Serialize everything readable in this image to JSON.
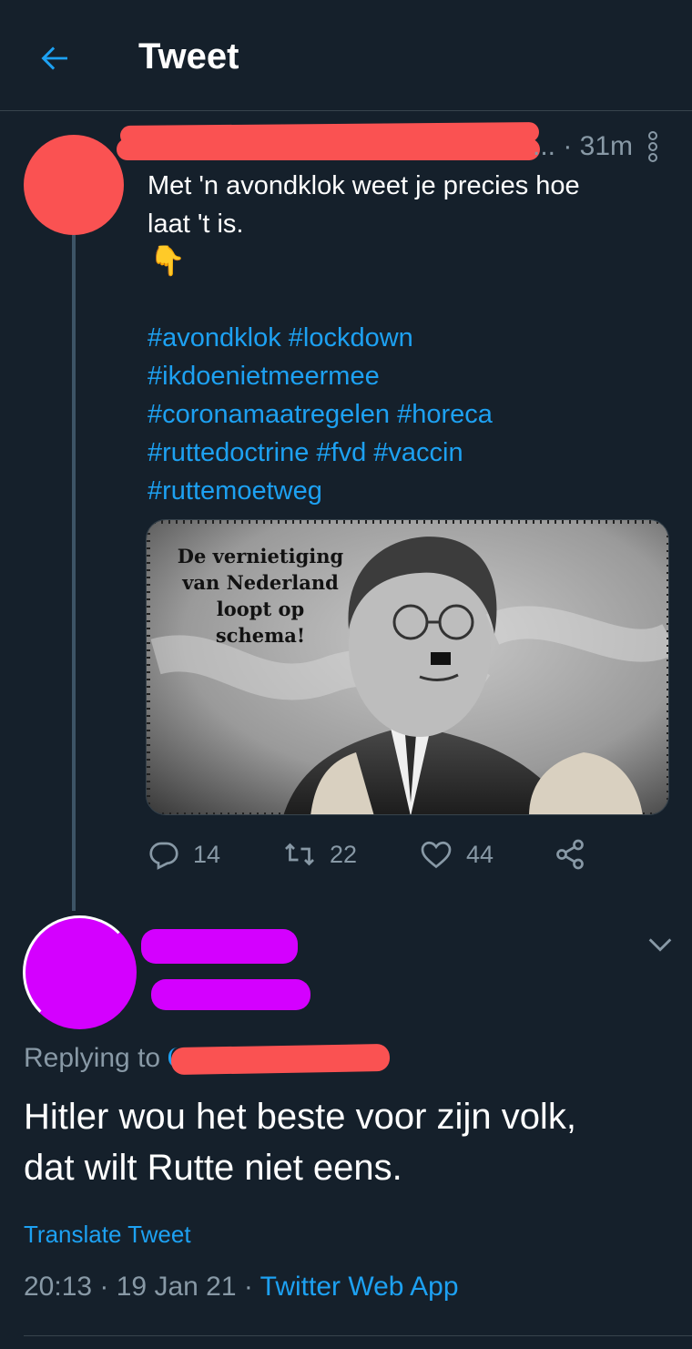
{
  "header": {
    "title": "Tweet",
    "back_icon": "arrow-left-icon"
  },
  "tweet": {
    "time_ago": "31m",
    "separator": "... · ",
    "text_line1": "Met 'n avondklok weet je precies hoe",
    "text_line2": "laat 't is.",
    "emoji": "👇",
    "hashtags": [
      "#avondklok",
      "#lockdown",
      "#ikdoenietmeermee",
      "#coronamaatregelen",
      "#horeca",
      "#ruttedoctrine",
      "#fvd",
      "#vaccin",
      "#ruttemoetweg"
    ],
    "media_caption_lines": [
      "De vernietiging",
      "van Nederland",
      "loopt op",
      "schema!"
    ],
    "stats": {
      "replies": "14",
      "retweets": "22",
      "likes": "44"
    }
  },
  "reply": {
    "replying_to_label": "Replying to",
    "text_line1": "Hitler wou het beste voor zijn volk,",
    "text_line2": "dat wilt Rutte niet eens.",
    "translate_label": "Translate Tweet",
    "time": "20:13",
    "date": "19 Jan 21",
    "dot": " · ",
    "source": "Twitter Web App"
  },
  "colors": {
    "background": "#15202b",
    "accent": "#1da1f2",
    "secondary_text": "#8899a6",
    "redaction_red": "#fa5252",
    "redaction_magenta": "#d400ff"
  }
}
